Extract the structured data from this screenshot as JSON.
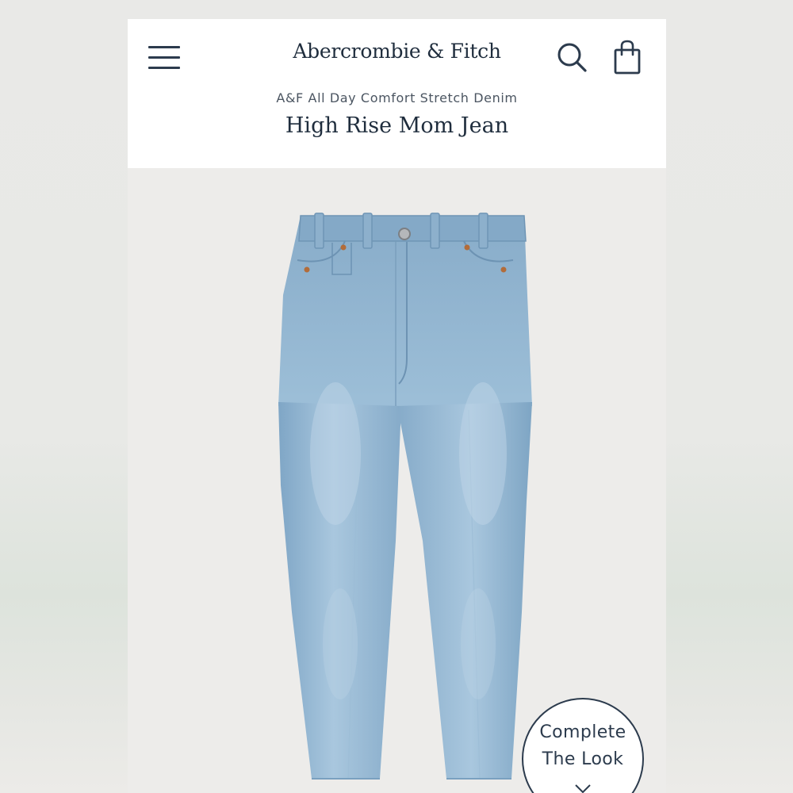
{
  "header": {
    "brand": "Abercrombie & Fitch",
    "menu_icon": "hamburger-menu-icon",
    "search_icon": "search-icon",
    "bag_icon": "shopping-bag-icon"
  },
  "product": {
    "collection": "A&F All Day Comfort Stretch Denim",
    "title": "High Rise Mom Jean",
    "image_subject": "jeans-icon"
  },
  "complete_look": {
    "line1": "Complete",
    "line2": "The Look",
    "icon": "chevron-down-icon"
  },
  "colors": {
    "navy": "#1f2d3d",
    "denim": "#8fb4d0",
    "background": "#ecebe9"
  }
}
